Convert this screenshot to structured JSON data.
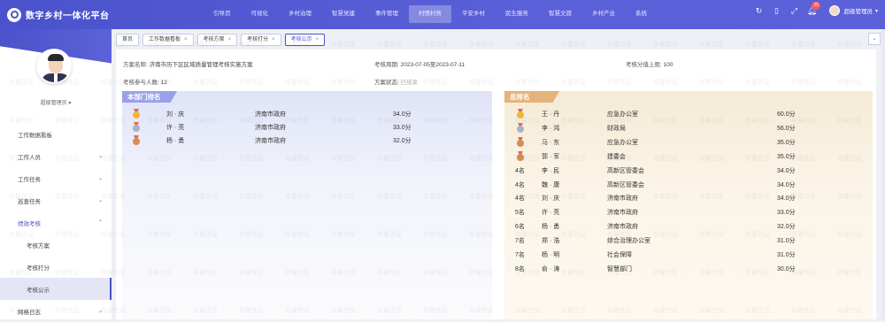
{
  "app": {
    "title": "数字乡村一体化平台"
  },
  "nav": [
    "引导页",
    "可视化",
    "乡村治理",
    "智慧党建",
    "事件管理",
    "村情村务",
    "平安乡村",
    "民生服务",
    "智慧文旅",
    "乡村产业",
    "系统"
  ],
  "nav_active_index": 5,
  "top": {
    "badge_count": "25",
    "user_name": "超级管理员"
  },
  "sidebar": {
    "user_name": "超级管理员",
    "menu": [
      {
        "label": "工作数据看板"
      },
      {
        "label": "工作人员"
      },
      {
        "label": "工作任务"
      },
      {
        "label": "巡查任务"
      },
      {
        "label": "绩效考核"
      }
    ],
    "sub": [
      "考核方案",
      "考核打分",
      "考核公示"
    ],
    "last": "网格日志"
  },
  "tabs": [
    {
      "label": "首页",
      "closable": false
    },
    {
      "label": "工作数据看板",
      "closable": true
    },
    {
      "label": "考核方案",
      "closable": true
    },
    {
      "label": "考核打分",
      "closable": true
    },
    {
      "label": "考核公示",
      "closable": true
    }
  ],
  "info": {
    "plan_label": "方案名称:",
    "plan_value": "济南市历下区区域质量管理考核实施方案",
    "period_label": "考核周期:",
    "period_value": "2023-07-05至2023-07-11",
    "cap_label": "考核分值上限:",
    "cap_value": "100",
    "count_label": "考核参与人数:",
    "count_value": "12",
    "status_label": "方案状态:",
    "status_value": "已结束"
  },
  "dept_rank": {
    "title": "本部门排名",
    "rows": [
      {
        "name": "刘 · 庆",
        "org": "济南市政府",
        "score": "34.0分",
        "medal": "gold"
      },
      {
        "name": "许 · 亮",
        "org": "济南市政府",
        "score": "33.0分",
        "medal": "silver"
      },
      {
        "name": "杨 · 勇",
        "org": "济南市政府",
        "score": "32.0分",
        "medal": "bronze"
      }
    ]
  },
  "total_rank": {
    "title": "总排名",
    "rows": [
      {
        "rank": "",
        "medal": "gold",
        "name": "王 · 丹",
        "org": "应急办公室",
        "score": "60.0分"
      },
      {
        "rank": "",
        "medal": "silver",
        "name": "李 · 鸿",
        "org": "财政局",
        "score": "56.0分"
      },
      {
        "rank": "",
        "medal": "bronze",
        "name": "马 · 东",
        "org": "应急办公室",
        "score": "35.0分"
      },
      {
        "rank": "",
        "medal": "bronze",
        "name": "郭 · 军",
        "org": "建委会",
        "score": "35.0分"
      },
      {
        "rank": "4名",
        "medal": "",
        "name": "李 · 民",
        "org": "高新区管委会",
        "score": "34.0分"
      },
      {
        "rank": "4名",
        "medal": "",
        "name": "魏 · 康",
        "org": "高新区管委会",
        "score": "34.0分"
      },
      {
        "rank": "4名",
        "medal": "",
        "name": "刘 · 庆",
        "org": "济南市政府",
        "score": "34.0分"
      },
      {
        "rank": "5名",
        "medal": "",
        "name": "许 · 亮",
        "org": "济南市政府",
        "score": "33.0分"
      },
      {
        "rank": "6名",
        "medal": "",
        "name": "杨 · 勇",
        "org": "济南市政府",
        "score": "32.0分"
      },
      {
        "rank": "7名",
        "medal": "",
        "name": "郑 · 浩",
        "org": "综合治理办公室",
        "score": "31.0分"
      },
      {
        "rank": "7名",
        "medal": "",
        "name": "杨 · 明",
        "org": "社会保障",
        "score": "31.0分"
      },
      {
        "rank": "8名",
        "medal": "",
        "name": "俞 · 涛",
        "org": "智慧部门",
        "score": "30.0分"
      }
    ]
  },
  "watermark": "存量信息",
  "colors": {
    "primary": "#4a52cc",
    "dept_header": "#9aa1ea",
    "total_header": "#e3b37a"
  }
}
